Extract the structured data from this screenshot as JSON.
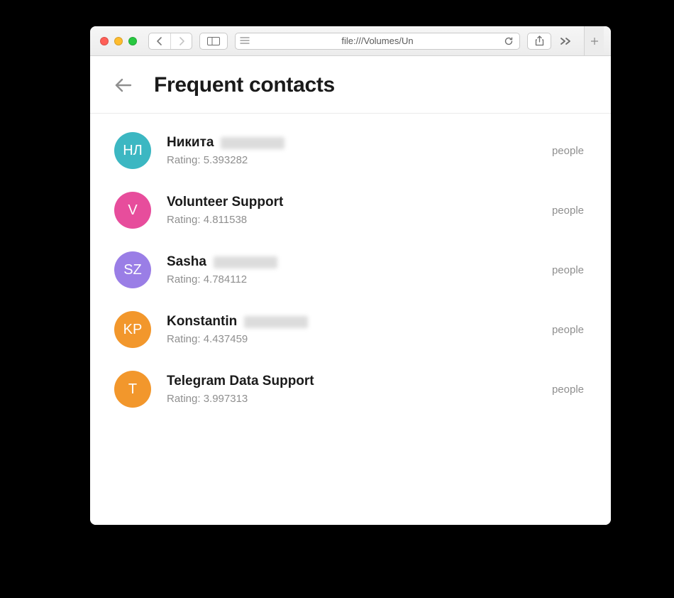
{
  "browser": {
    "url": "file:///Volumes/Un"
  },
  "page": {
    "title": "Frequent contacts",
    "rating_prefix": "Rating: "
  },
  "contacts": [
    {
      "initials": "НЛ",
      "avatar_color": "#3cb7c2",
      "name_visible": "Никита",
      "name_redacted": true,
      "rating": "5.393282",
      "tag": "people"
    },
    {
      "initials": "V",
      "avatar_color": "#e74d9c",
      "name_visible": "Volunteer Support",
      "name_redacted": false,
      "rating": "4.811538",
      "tag": "people"
    },
    {
      "initials": "SZ",
      "avatar_color": "#9a7ee6",
      "name_visible": "Sasha",
      "name_redacted": true,
      "rating": "4.784112",
      "tag": "people"
    },
    {
      "initials": "KP",
      "avatar_color": "#f2972c",
      "name_visible": "Konstantin",
      "name_redacted": true,
      "rating": "4.437459",
      "tag": "people"
    },
    {
      "initials": "T",
      "avatar_color": "#f2972c",
      "name_visible": "Telegram Data Support",
      "name_redacted": false,
      "rating": "3.997313",
      "tag": "people"
    }
  ]
}
